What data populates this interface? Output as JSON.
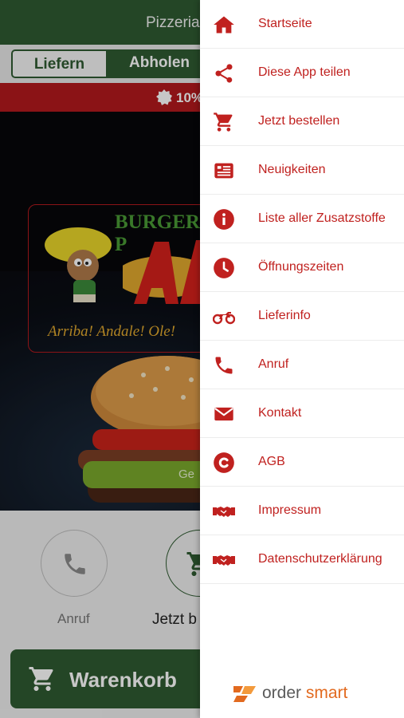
{
  "header": {
    "title": "Pizzeria"
  },
  "mode_toggle": {
    "deliver_label": "Liefern",
    "pickup_label": "Abholen"
  },
  "promo": {
    "text": "10%"
  },
  "hero": {
    "logo_title": "BURGER-P",
    "logo_slogan": "Arriba! Andale! Ole!",
    "order_pill_text": "Ge"
  },
  "quick_actions": [
    {
      "label": "Anruf",
      "icon": "phone-icon"
    },
    {
      "label": "Jetzt b",
      "icon": "cart-icon"
    }
  ],
  "cart": {
    "label": "Warenkorb"
  },
  "menu": {
    "items": [
      {
        "label": "Startseite",
        "icon": "home-icon"
      },
      {
        "label": "Diese App teilen",
        "icon": "share-icon"
      },
      {
        "label": "Jetzt bestellen",
        "icon": "cart-icon"
      },
      {
        "label": "Neuigkeiten",
        "icon": "news-icon"
      },
      {
        "label": "Liste aller Zusatzstoffe",
        "icon": "info-icon"
      },
      {
        "label": "Öffnungszeiten",
        "icon": "clock-icon"
      },
      {
        "label": "Lieferinfo",
        "icon": "motorcycle-icon"
      },
      {
        "label": "Anruf",
        "icon": "phone-icon"
      },
      {
        "label": "Kontakt",
        "icon": "envelope-icon"
      },
      {
        "label": "AGB",
        "icon": "copyright-icon"
      },
      {
        "label": "Impressum",
        "icon": "handshake-icon"
      },
      {
        "label": "Datenschutzerklärung",
        "icon": "handshake-icon"
      }
    ]
  },
  "brand": {
    "name_part1": "order",
    "name_part2": "smart"
  },
  "colors": {
    "accent_red": "#c0211f",
    "header_green": "#2f5a31",
    "promo_red": "#b3191d",
    "brand_orange": "#e26a1f"
  }
}
